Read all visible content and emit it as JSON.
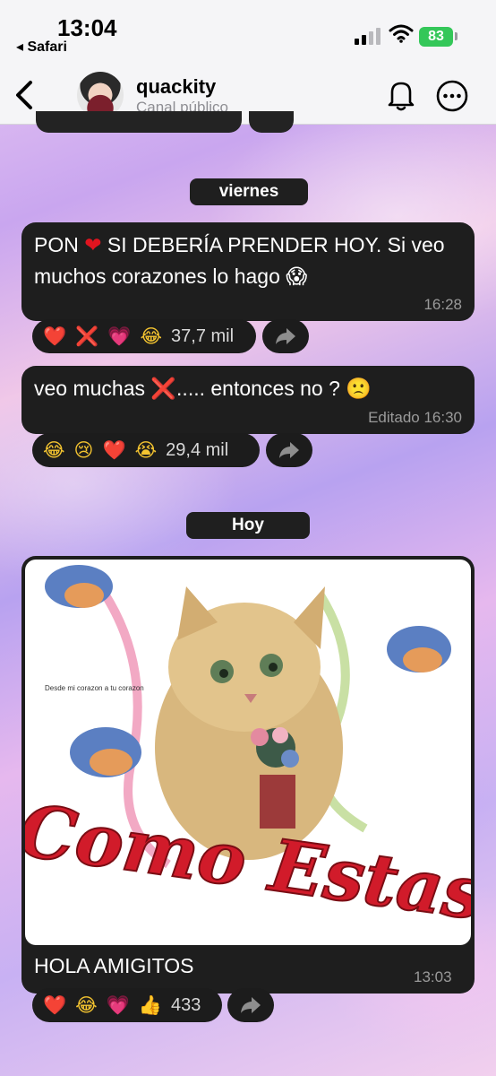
{
  "status": {
    "time": "13:04",
    "back_app": "◂ Safari",
    "battery": "83"
  },
  "header": {
    "channel_name": "quackity",
    "channel_type": "Canal público"
  },
  "dates": {
    "first": "viernes",
    "second": "Hoy"
  },
  "messages": [
    {
      "text_a": "PON ",
      "text_b": " SI DEBERÍA PRENDER HOY. Si veo muchos corazones lo hago ",
      "emoji_end": "😱",
      "time": "16:28",
      "reactions": [
        "❤️",
        "❌",
        "💗",
        "😂"
      ],
      "count": "37,7 mil"
    },
    {
      "text_a": "veo muchas ",
      "text_b": "..... entonces no ? ",
      "emoji_end": "🙁",
      "time": "Editado 16:30",
      "reactions": [
        "😂",
        "😢",
        "❤️",
        "😭"
      ],
      "count": "29,4 mil"
    },
    {
      "caption": "HOLA AMIGITOS",
      "time": "13:03",
      "image_text": "Como Estas",
      "image_small_text": "Desde mi corazon a tu corazon",
      "reactions": [
        "❤️",
        "😂",
        "💗",
        "👍"
      ],
      "count": "433"
    }
  ],
  "colors": {
    "bubble": "#1e1e1e",
    "accent_red": "#e0141f",
    "battery": "#34c759"
  }
}
